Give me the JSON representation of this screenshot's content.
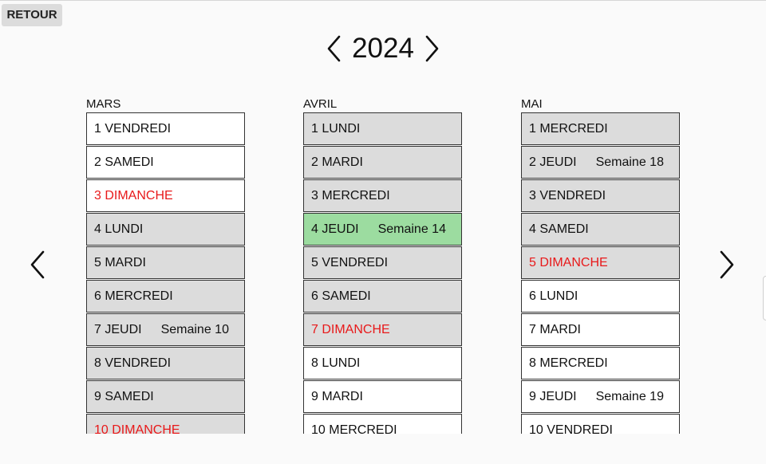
{
  "header": {
    "back_label": "RETOUR",
    "year": "2024"
  },
  "icons": {
    "prev_year": "chevron-left-icon",
    "next_year": "chevron-right-icon",
    "prev_page": "chevron-left-icon",
    "next_page": "chevron-right-icon"
  },
  "colors": {
    "selected": "#9cdca0",
    "sunday_text": "#e8191a",
    "shaded": "#dcdcdc"
  },
  "months": [
    {
      "name": "MARS",
      "days": [
        {
          "label": "1 VENDREDI",
          "week": "",
          "state": "normal",
          "sunday": false
        },
        {
          "label": "2 SAMEDI",
          "week": "",
          "state": "normal",
          "sunday": false
        },
        {
          "label": "3 DIMANCHE",
          "week": "",
          "state": "normal",
          "sunday": true
        },
        {
          "label": "4 LUNDI",
          "week": "",
          "state": "shaded",
          "sunday": false
        },
        {
          "label": "5 MARDI",
          "week": "",
          "state": "shaded",
          "sunday": false
        },
        {
          "label": "6 MERCREDI",
          "week": "",
          "state": "shaded",
          "sunday": false
        },
        {
          "label": "7 JEUDI",
          "week": "Semaine 10",
          "state": "shaded",
          "sunday": false
        },
        {
          "label": "8 VENDREDI",
          "week": "",
          "state": "shaded",
          "sunday": false
        },
        {
          "label": "9 SAMEDI",
          "week": "",
          "state": "shaded",
          "sunday": false
        },
        {
          "label": "10 DIMANCHE",
          "week": "",
          "state": "shaded",
          "sunday": true
        }
      ]
    },
    {
      "name": "AVRIL",
      "days": [
        {
          "label": "1 LUNDI",
          "week": "",
          "state": "shaded",
          "sunday": false
        },
        {
          "label": "2 MARDI",
          "week": "",
          "state": "shaded",
          "sunday": false
        },
        {
          "label": "3 MERCREDI",
          "week": "",
          "state": "shaded",
          "sunday": false
        },
        {
          "label": "4 JEUDI",
          "week": "Semaine 14",
          "state": "today",
          "sunday": false
        },
        {
          "label": "5 VENDREDI",
          "week": "",
          "state": "shaded",
          "sunday": false
        },
        {
          "label": "6 SAMEDI",
          "week": "",
          "state": "shaded",
          "sunday": false
        },
        {
          "label": "7 DIMANCHE",
          "week": "",
          "state": "shaded",
          "sunday": true
        },
        {
          "label": "8 LUNDI",
          "week": "",
          "state": "normal",
          "sunday": false
        },
        {
          "label": "9 MARDI",
          "week": "",
          "state": "normal",
          "sunday": false
        },
        {
          "label": "10 MERCREDI",
          "week": "",
          "state": "normal",
          "sunday": false
        }
      ]
    },
    {
      "name": "MAI",
      "days": [
        {
          "label": "1 MERCREDI",
          "week": "",
          "state": "shaded",
          "sunday": false
        },
        {
          "label": "2 JEUDI",
          "week": "Semaine 18",
          "state": "shaded",
          "sunday": false
        },
        {
          "label": "3 VENDREDI",
          "week": "",
          "state": "shaded",
          "sunday": false
        },
        {
          "label": "4 SAMEDI",
          "week": "",
          "state": "shaded",
          "sunday": false
        },
        {
          "label": "5 DIMANCHE",
          "week": "",
          "state": "shaded",
          "sunday": true
        },
        {
          "label": "6 LUNDI",
          "week": "",
          "state": "normal",
          "sunday": false
        },
        {
          "label": "7 MARDI",
          "week": "",
          "state": "normal",
          "sunday": false
        },
        {
          "label": "8 MERCREDI",
          "week": "",
          "state": "normal",
          "sunday": false
        },
        {
          "label": "9 JEUDI",
          "week": "Semaine 19",
          "state": "normal",
          "sunday": false
        },
        {
          "label": "10 VENDREDI",
          "week": "",
          "state": "normal",
          "sunday": false
        }
      ]
    }
  ]
}
